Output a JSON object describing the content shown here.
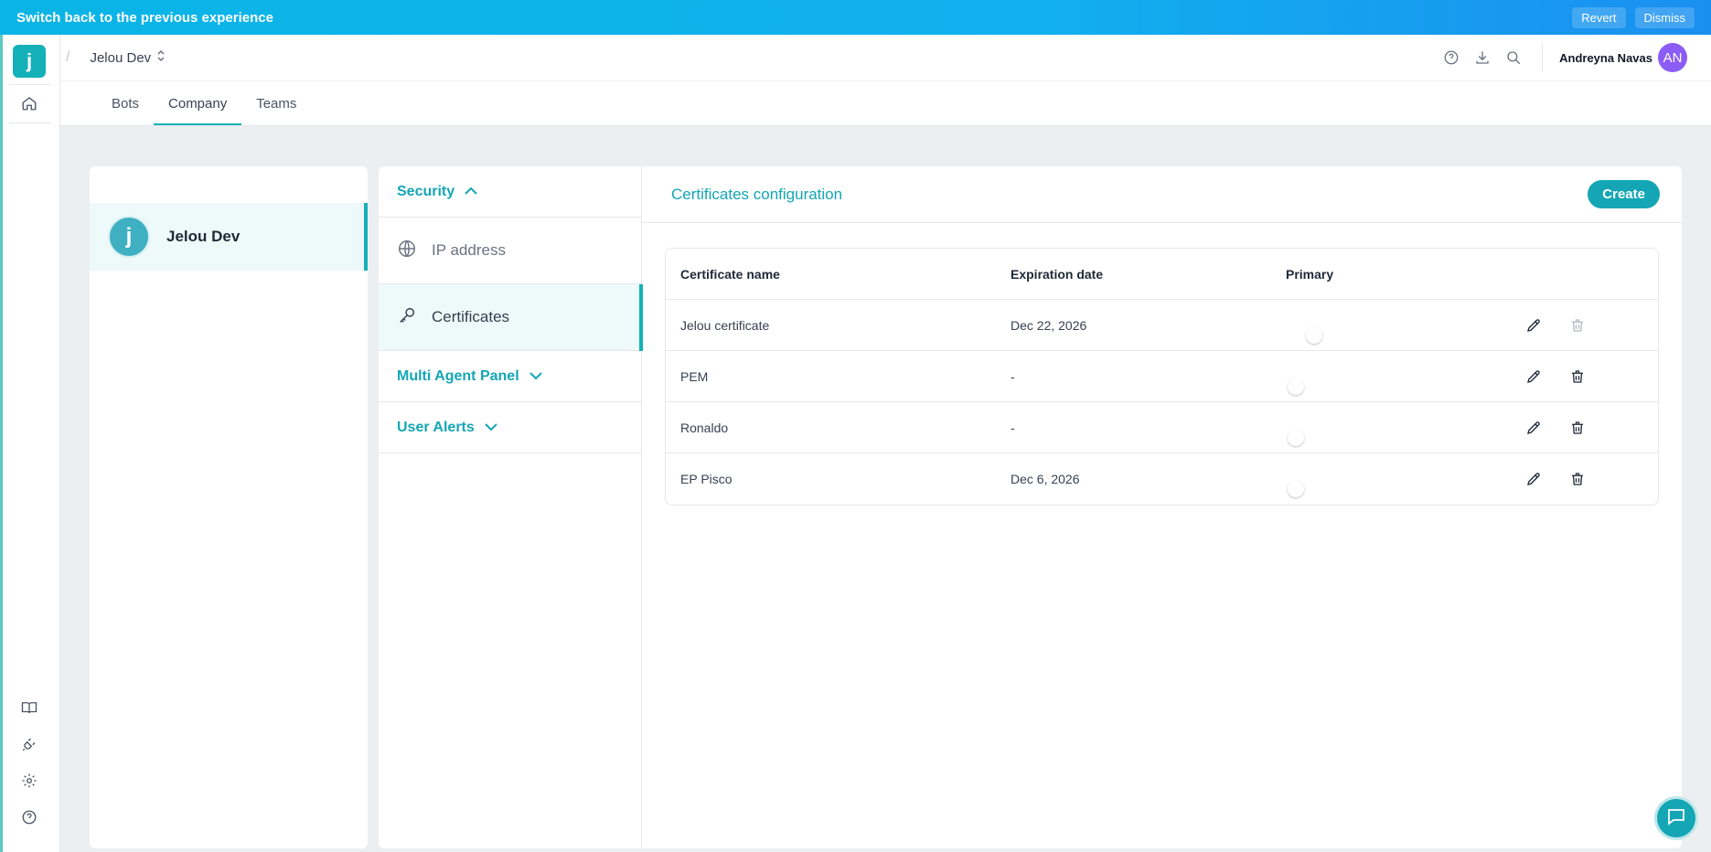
{
  "banner": {
    "message": "Switch back to the previous experience",
    "revert": "Revert",
    "dismiss": "Dismiss"
  },
  "app": {
    "logo_letter": "j"
  },
  "header": {
    "crumb_separator": "/",
    "workspace": "Jelou Dev",
    "user_name": "Andreyna Navas",
    "user_initials": "AN"
  },
  "tabs": [
    {
      "label": "Bots"
    },
    {
      "label": "Company"
    },
    {
      "label": "Teams"
    }
  ],
  "company": {
    "name": "Jelou Dev",
    "logo_letter": "j"
  },
  "menu": {
    "security": "Security",
    "ip_address": "IP address",
    "certificates": "Certificates",
    "multi_agent_panel": "Multi Agent Panel",
    "user_alerts": "User Alerts"
  },
  "config": {
    "title": "Certificates configuration",
    "create": "Create"
  },
  "table": {
    "headers": {
      "name": "Certificate name",
      "expiration": "Expiration date",
      "primary": "Primary"
    },
    "rows": [
      {
        "name": "Jelou certificate",
        "expiration": "Dec 22, 2026",
        "primary": true
      },
      {
        "name": "PEM",
        "expiration": "-",
        "primary": false
      },
      {
        "name": "Ronaldo",
        "expiration": "-",
        "primary": false
      },
      {
        "name": "EP Pisco",
        "expiration": "Dec 6, 2026",
        "primary": false
      }
    ]
  },
  "colors": {
    "accent": "#14a6b5",
    "toggle_on": "#34c77b",
    "avatar": "#8b5cf6"
  }
}
